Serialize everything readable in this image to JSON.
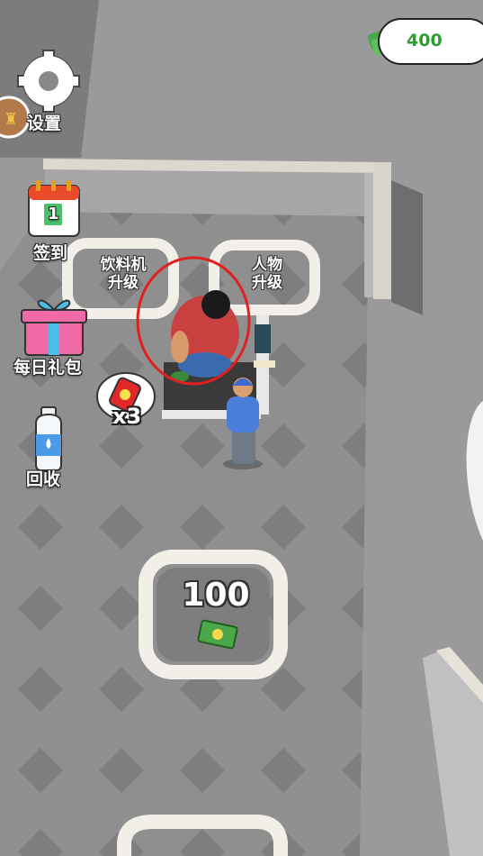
{
  "currency": {
    "amount": "400",
    "icon": "cash-stack-icon"
  },
  "side_menu": {
    "settings_label": "设置",
    "checkin_label": "签到",
    "checkin_day": "1",
    "daily_gift_label": "每日礼包",
    "recycle_label": "回收"
  },
  "upgrade_pads": {
    "drink_machine_label_1": "饮料机",
    "drink_machine_label_2": "升级",
    "character_label_1": "人物",
    "character_label_2": "升级"
  },
  "drink_counter": {
    "count": "x3",
    "icon": "soda-can-icon"
  },
  "purchase_pad": {
    "price": "100",
    "icon": "cash-icon"
  },
  "colors": {
    "floor": "#8e8e8e",
    "floor_diamond": "#7f7f7f",
    "wall_top": "#d8d4cc",
    "wall_face": "#a8a8a8",
    "pad_border": "#f2efe8",
    "highlight_circle": "#e02020",
    "money_text": "#2e9e2e"
  }
}
